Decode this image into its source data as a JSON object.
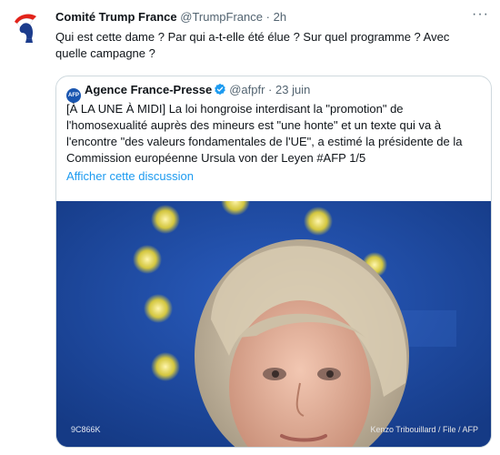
{
  "tweet": {
    "author_name": "Comité Trump France",
    "handle": "@TrumpFrance",
    "separator": "·",
    "time": "2h",
    "more_label": "···",
    "text": "Qui est cette dame ? Par qui a-t-elle été élue ? Sur quel programme ? Avec quelle campagne ?",
    "avatar_icon": "red-white-blue-profile-logo-icon"
  },
  "quoted": {
    "logo_text": "AFP",
    "author_name": "Agence France-Presse",
    "verified_icon": "verified-badge-icon",
    "handle": "@afpfr",
    "separator": "·",
    "date": "23 juin",
    "text": "[À LA UNE À MIDI] La loi hongroise interdisant la \"promotion\" de l'homosexualité auprès des mineurs est \"une honte\" et un texte qui va à l'encontre \"des valeurs fondamentales de l'UE\", a estimé la présidente de la Commission européenne Ursula von der Leyen #AFP 1/5",
    "show_thread": "Afficher cette discussion",
    "image": {
      "id_caption": "9C866K",
      "credit": "Kenzo Tribouillard / File / AFP"
    }
  },
  "colors": {
    "link": "#1d9bf0",
    "border": "#cfd9de",
    "secondary_text": "#536471",
    "eu_blue": "#1d4a9e",
    "eu_star": "#f3dc2e"
  }
}
